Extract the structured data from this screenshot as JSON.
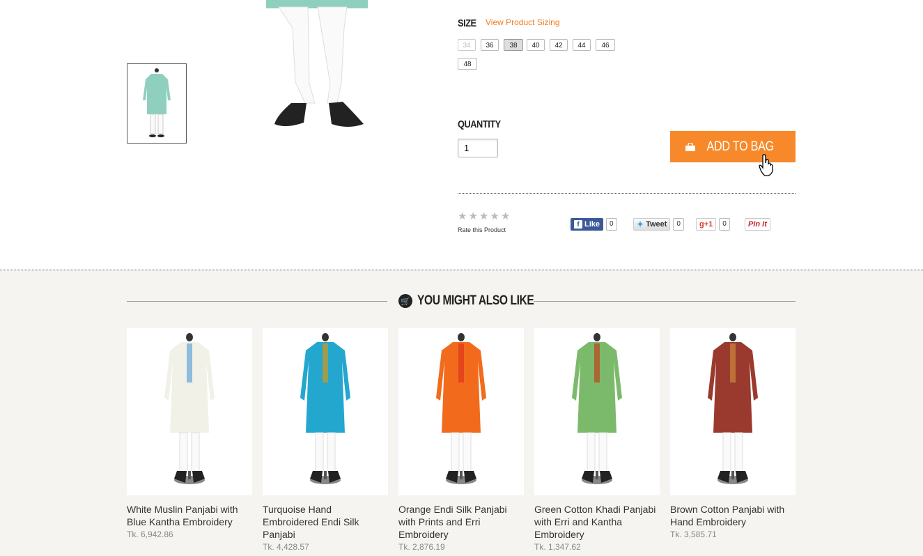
{
  "size": {
    "title": "SIZE",
    "sizing_link": "View Product Sizing",
    "options": [
      "34",
      "36",
      "38",
      "40",
      "42",
      "44",
      "46",
      "48"
    ],
    "disabled": [
      "34"
    ],
    "selected": "38"
  },
  "quantity": {
    "title": "QUANTITY",
    "value": "1"
  },
  "add_to_bag": {
    "label": "ADD TO BAG"
  },
  "rating": {
    "label": "Rate this Product",
    "stars": 5,
    "filled": 0
  },
  "social": {
    "like_label": "Like",
    "like_count": "0",
    "tweet_label": "Tweet",
    "tweet_count": "0",
    "gplus_label": "+1",
    "gplus_count": "0",
    "pin_label": "Pin it"
  },
  "related": {
    "title": "YOU MIGHT ALSO LIKE",
    "products": [
      {
        "name": "White Muslin Panjabi with Blue Kantha Embroidery",
        "price": "Tk. 6,942.86",
        "color": "#f1f1e8",
        "accent": "#7bb3d9"
      },
      {
        "name": "Turquoise Hand Embroidered Endi Silk Panjabi",
        "price": "Tk. 4,428.57",
        "color": "#23a7cf",
        "accent": "#b49a3a"
      },
      {
        "name": "Orange Endi Silk Panjabi with Prints and Erri Embroidery",
        "price": "Tk. 2,876.19",
        "color": "#f26b1d",
        "accent": "#e0401a"
      },
      {
        "name": "Green Cotton Khadi Panjabi with Erri and Kantha Embroidery",
        "price": "Tk. 1,347.62",
        "color": "#7cba6b",
        "accent": "#b5562c"
      },
      {
        "name": "Brown Cotton Panjabi with Hand Embroidery",
        "price": "Tk. 3,585.71",
        "color": "#9a3a2e",
        "accent": "#c47a3a"
      }
    ]
  },
  "product_image": {
    "color": "#8fcfbd"
  }
}
